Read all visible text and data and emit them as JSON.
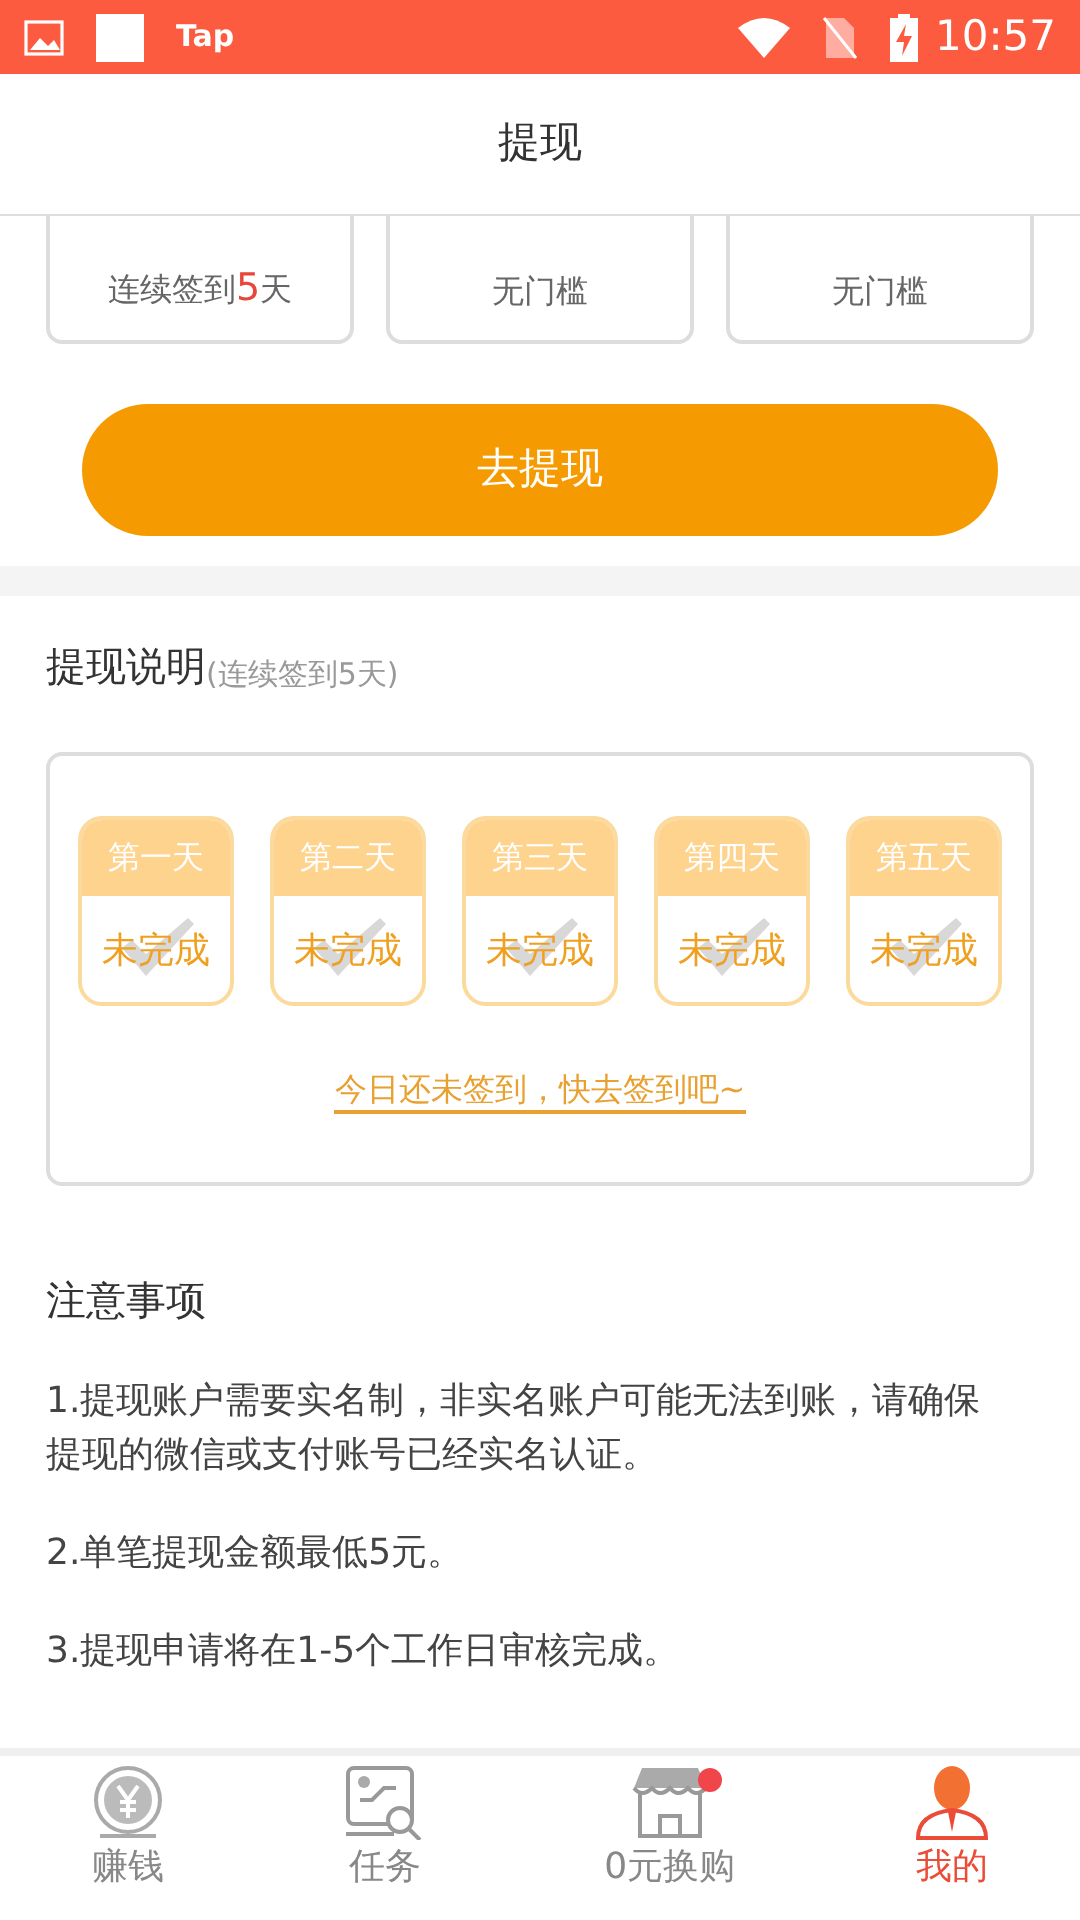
{
  "status_bar": {
    "app_label": "Tap",
    "time": "10:57"
  },
  "header": {
    "title": "提现"
  },
  "options": [
    {
      "label": "连续签到",
      "highlight": "5",
      "label_end": "天"
    },
    {
      "label": "无门槛"
    },
    {
      "label": "无门槛"
    }
  ],
  "withdraw_button": "去提现",
  "explanation": {
    "title": "提现说明",
    "subtitle": "(连续签到5天)",
    "days": [
      {
        "label": "第一天",
        "status": "未完成",
        "checked": false
      },
      {
        "label": "第二天",
        "status": "未完成",
        "checked": false
      },
      {
        "label": "第三天",
        "status": "未完成",
        "checked": false
      },
      {
        "label": "第四天",
        "status": "未完成",
        "checked": false
      },
      {
        "label": "第五天",
        "status": "未完成",
        "checked": false
      }
    ],
    "sign_link": "今日还未签到，快去签到吧~"
  },
  "notes": {
    "title": "注意事项",
    "items": [
      "1.提现账户需要实名制，非实名账户可能无法到账，请确保提现的微信或支付账号已经实名认证。",
      "2.单笔提现金额最低5元。",
      "3.提现申请将在1-5个工作日审核完成。"
    ]
  },
  "bottom_nav": [
    {
      "kind": "coin",
      "label": "赚钱",
      "selected": false,
      "badge": false
    },
    {
      "kind": "task",
      "label": "任务",
      "selected": false,
      "badge": false
    },
    {
      "kind": "shop",
      "label": "0元换购",
      "selected": false,
      "badge": true
    },
    {
      "kind": "person",
      "label": "我的",
      "selected": true,
      "badge": false
    }
  ]
}
